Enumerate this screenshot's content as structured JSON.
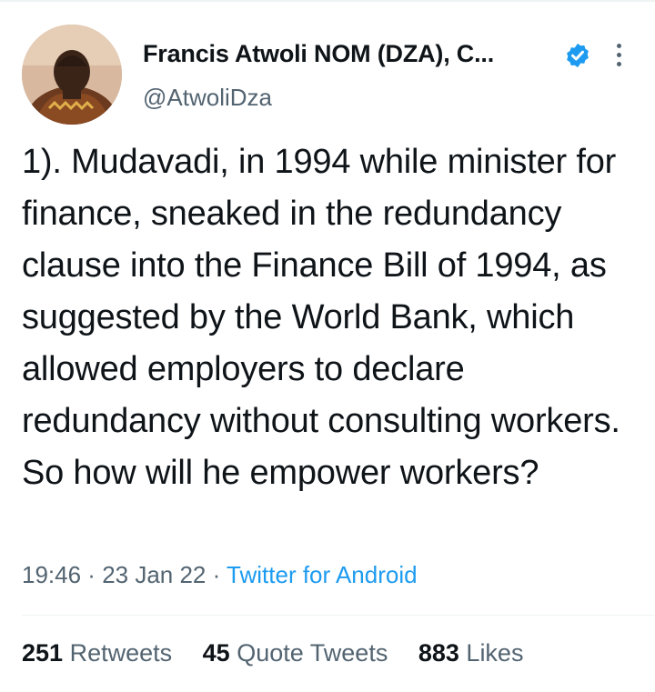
{
  "author": {
    "name": "Francis Atwoli NOM (DZA), C...",
    "handle": "@AtwoliDza",
    "avatar_icon": "profile-photo",
    "verified_icon": "verified-badge-icon",
    "verified_color": "#1d9bf0"
  },
  "tweet": {
    "text": "1). Mudavadi, in 1994 while minister for finance, sneaked in the redundancy clause into the Finance Bill of 1994, as suggested by the World Bank, which allowed employers to declare redundancy without consulting workers. So how will he empower workers?",
    "time": "19:46",
    "date": "23 Jan 22",
    "source": "Twitter for Android",
    "separator": " · "
  },
  "stats": {
    "retweets_count": "251",
    "retweets_label": "Retweets",
    "quotes_count": "45",
    "quotes_label": "Quote Tweets",
    "likes_count": "883",
    "likes_label": "Likes"
  },
  "colors": {
    "accent": "#1d9bf0",
    "text": "#0f1419",
    "secondary": "#536471",
    "divider": "#eff3f4"
  }
}
